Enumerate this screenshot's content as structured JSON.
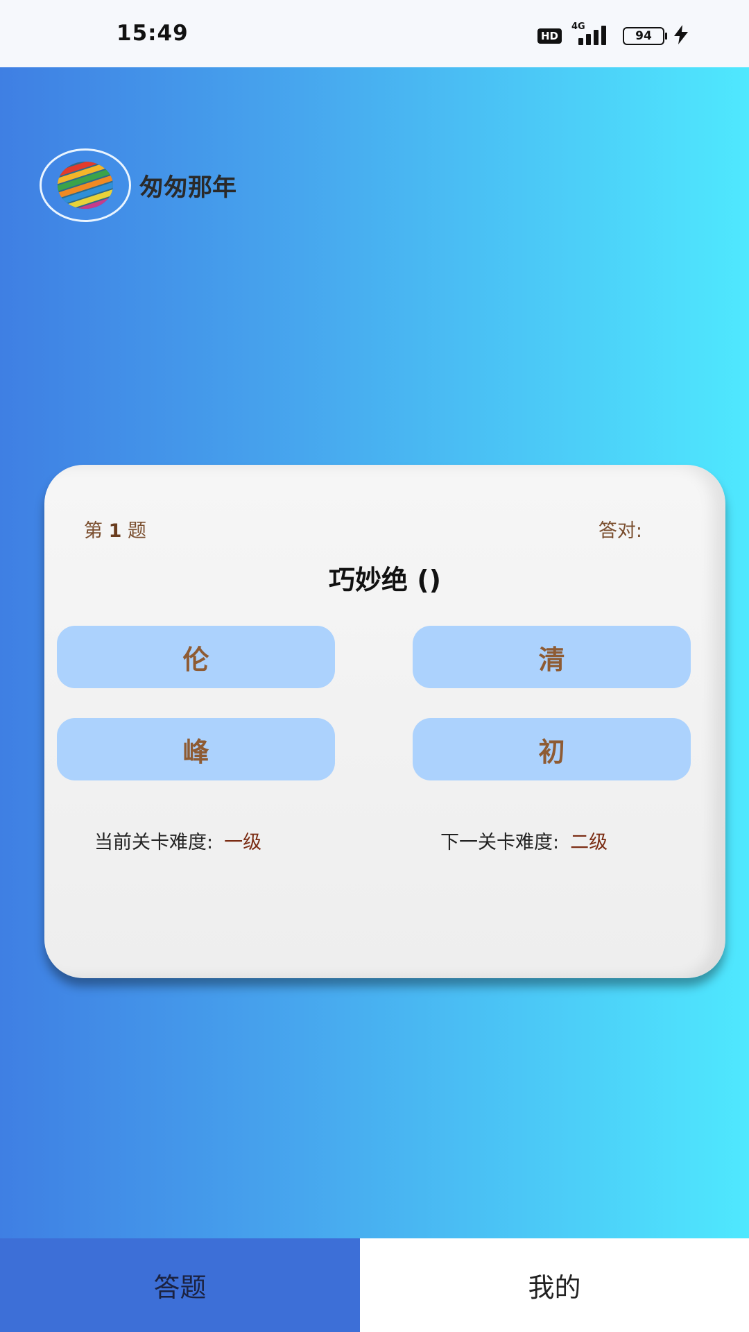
{
  "status_bar": {
    "time": "15:49",
    "hd_label": "HD",
    "network": "4G",
    "battery": "94",
    "icons": [
      "hd-icon",
      "signal-icon",
      "battery-icon",
      "charging-bolt-icon"
    ]
  },
  "header": {
    "app_name": "匆匆那年",
    "logo_icon": "globe-stripes-logo"
  },
  "quiz": {
    "question_prefix": "第",
    "question_number": "1",
    "question_suffix": "题",
    "correct_label": "答对:",
    "question_text": "巧妙绝 ()",
    "options": [
      "伦",
      "清",
      "峰",
      "初"
    ],
    "current_level_label": "当前关卡难度:",
    "current_level_value": "一级",
    "next_level_label": "下一关卡难度:",
    "next_level_value": "二级"
  },
  "tabs": [
    {
      "label": "答题",
      "active": true
    },
    {
      "label": "我的",
      "active": false
    }
  ],
  "colors": {
    "gradient_start": "#3f7fe3",
    "gradient_end": "#4fe8fe",
    "option_bg": "#acd2fd",
    "option_text": "#8e5b33",
    "tab_active_bg": "#3d6fd7"
  }
}
